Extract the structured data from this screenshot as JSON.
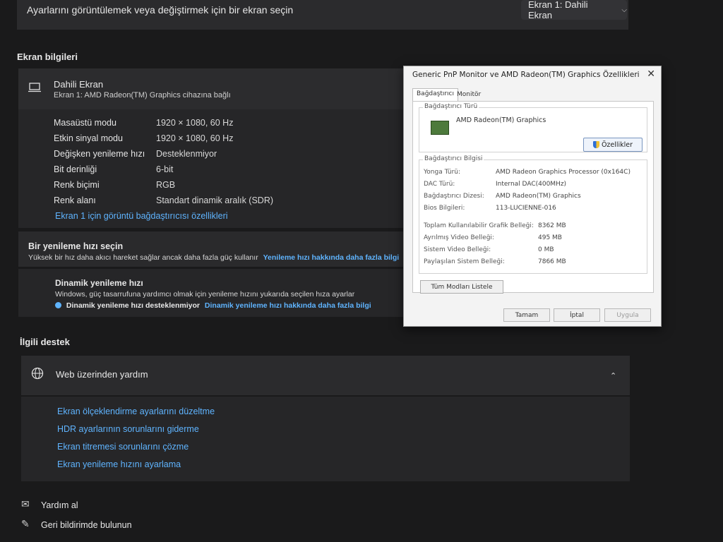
{
  "header": {
    "prompt": "Ayarlarını görüntülemek veya değiştirmek için bir ekran seçin",
    "selected_display": "Ekran 1: Dahili Ekran"
  },
  "display_info": {
    "section_title": "Ekran bilgileri",
    "name": "Dahili Ekran",
    "subtitle": "Ekran 1: AMD Radeon(TM) Graphics cihazına bağlı",
    "rows": [
      {
        "label": "Masaüstü modu",
        "value": "1920 × 1080, 60 Hz"
      },
      {
        "label": "Etkin sinyal modu",
        "value": "1920 × 1080, 60 Hz"
      },
      {
        "label": "Değişken yenileme hızı",
        "value": "Desteklenmiyor"
      },
      {
        "label": "Bit derinliği",
        "value": "6-bit"
      },
      {
        "label": "Renk biçimi",
        "value": "RGB"
      },
      {
        "label": "Renk alanı",
        "value": "Standart dinamik aralık (SDR)"
      }
    ],
    "adapter_link": "Ekran 1 için görüntü bağdaştırıcısı özellikleri"
  },
  "refresh": {
    "title": "Bir yenileme hızı seçin",
    "desc": "Yüksek bir hız daha akıcı hareket sağlar ancak daha fazla güç kullanır",
    "link": "Yenileme hızı hakkında daha fazla bilgi"
  },
  "dynamic": {
    "title": "Dinamik yenileme hızı",
    "desc": "Windows, güç tasarrufuna yardımcı olmak için yenileme hızını yukarıda seçilen hıza ayarlar",
    "status": "Dinamik yenileme hızı desteklenmiyor",
    "link": "Dinamik yenileme hızı hakkında daha fazla bilgi"
  },
  "support": {
    "section_title": "İlgili destek",
    "web_help": "Web üzerinden yardım",
    "links": [
      "Ekran ölçeklendirme ayarlarını düzeltme",
      "HDR ayarlarının sorunlarını giderme",
      "Ekran titremesi sorunlarını çözme",
      "Ekran yenileme hızını ayarlama"
    ]
  },
  "footer": {
    "get_help": "Yardım al",
    "feedback": "Geri bildirimde bulunun"
  },
  "dialog": {
    "title": "Generic PnP Monitor ve AMD Radeon(TM) Graphics Özellikleri",
    "tabs": [
      "Bağdaştırıcı",
      "Monitör"
    ],
    "adapter_type_label": "Bağdaştırıcı Türü",
    "adapter_type_name": "AMD Radeon(TM) Graphics",
    "properties_button": "Özellikler",
    "adapter_info_label": "Bağdaştırıcı Bilgisi",
    "info": [
      {
        "label": "Yonga Türü:",
        "value": "AMD Radeon Graphics Processor (0x164C)"
      },
      {
        "label": "DAC Türü:",
        "value": "Internal DAC(400MHz)"
      },
      {
        "label": "Bağdaştırıcı Dizesi:",
        "value": "AMD Radeon(TM) Graphics"
      },
      {
        "label": "Bios Bilgileri:",
        "value": "113-LUCIENNE-016"
      }
    ],
    "memory": [
      {
        "label": "Toplam Kullanılabilir Grafik Belleği:",
        "value": "8362 MB"
      },
      {
        "label": "Ayrılmış Video Belleği:",
        "value": "495 MB"
      },
      {
        "label": "Sistem Video Belleği:",
        "value": "0 MB"
      },
      {
        "label": "Paylaşılan Sistem Belleği:",
        "value": "7866 MB"
      }
    ],
    "list_modes_button": "Tüm Modları Listele",
    "ok": "Tamam",
    "cancel": "İptal",
    "apply": "Uygula"
  },
  "colors": {
    "accent_link": "#5fb4ff",
    "background": "#1a1a1b",
    "panel": "#2a2a2c"
  }
}
